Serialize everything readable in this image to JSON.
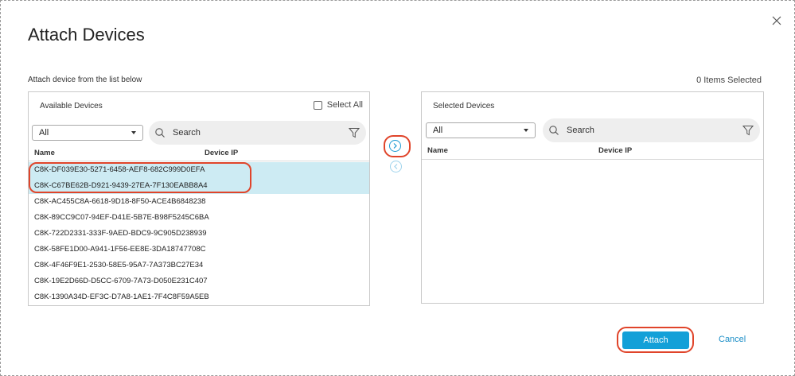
{
  "dialog": {
    "title": "Attach Devices",
    "subtitle": "Attach device from the list below",
    "items_selected": "0 Items Selected"
  },
  "available": {
    "panel_title": "Available Devices",
    "select_all_label": "Select All",
    "filter_value": "All",
    "search_placeholder": "Search",
    "col_name": "Name",
    "col_ip": "Device IP",
    "rows": [
      {
        "name": "C8K-DF039E30-5271-6458-AEF8-682C999D0EFA",
        "selected": true
      },
      {
        "name": "C8K-C67BE62B-D921-9439-27EA-7F130EABB8A4",
        "selected": true
      },
      {
        "name": "C8K-AC455C8A-6618-9D18-8F50-ACE4B6848238",
        "selected": false
      },
      {
        "name": "C8K-89CC9C07-94EF-D41E-5B7E-B98F5245C6BA",
        "selected": false
      },
      {
        "name": "C8K-722D2331-333F-9AED-BDC9-9C905D238939",
        "selected": false
      },
      {
        "name": "C8K-58FE1D00-A941-1F56-EE8E-3DA18747708C",
        "selected": false
      },
      {
        "name": "C8K-4F46F9E1-2530-58E5-95A7-7A373BC27E34",
        "selected": false
      },
      {
        "name": "C8K-19E2D66D-D5CC-6709-7A73-D050E231C407",
        "selected": false
      },
      {
        "name": "C8K-1390A34D-EF3C-D7A8-1AE1-7F4C8F59A5EB",
        "selected": false
      }
    ]
  },
  "selected": {
    "panel_title": "Selected Devices",
    "filter_value": "All",
    "search_placeholder": "Search",
    "col_name": "Name",
    "col_ip": "Device IP"
  },
  "actions": {
    "attach_label": "Attach",
    "cancel_label": "Cancel"
  },
  "colors": {
    "accent": "#13a0d8",
    "highlight_ring": "#e0442a",
    "row_selected": "#cdebf3"
  },
  "icons": {
    "close": "close-icon",
    "search": "search-icon",
    "filter": "filter-icon",
    "move_right": "chevron-right-icon",
    "move_left": "chevron-left-icon"
  }
}
